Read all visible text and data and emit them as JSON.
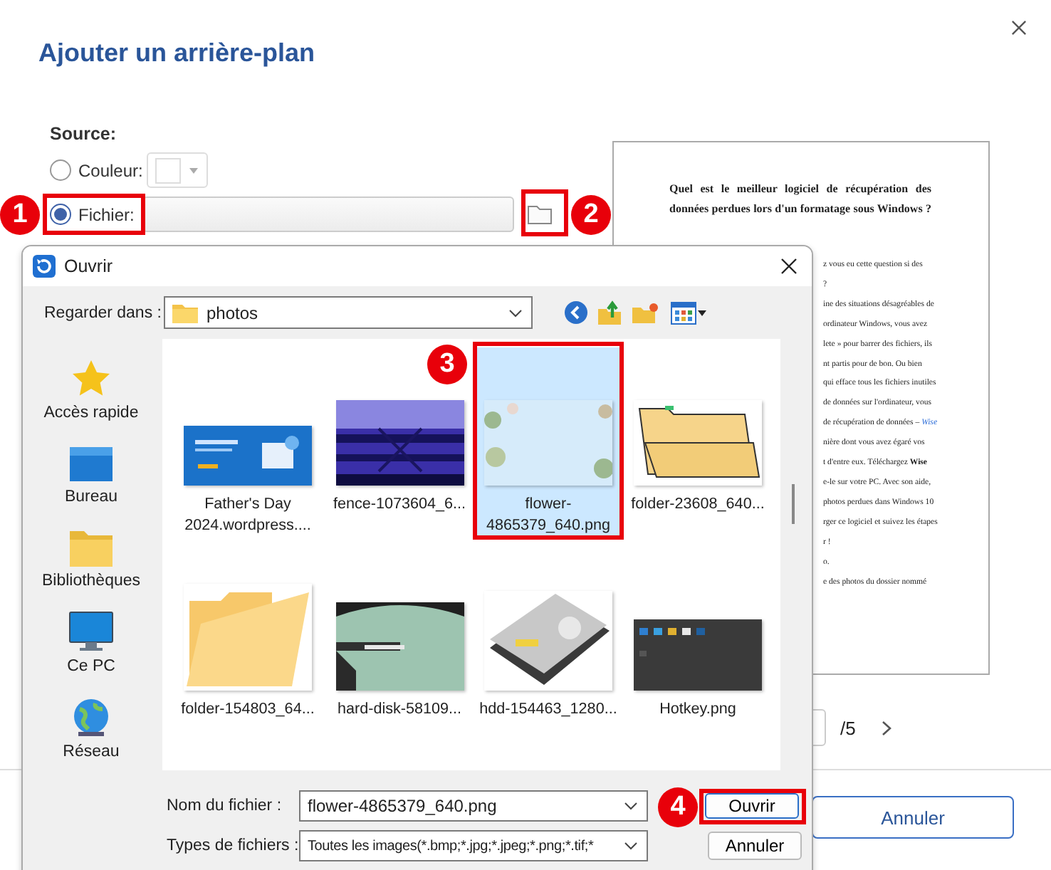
{
  "dialog": {
    "title": "Ajouter un arrière-plan"
  },
  "source": {
    "label": "Source:",
    "options": [
      {
        "kind": "color",
        "label": "Couleur:",
        "selected": false
      },
      {
        "kind": "file",
        "label": "Fichier:",
        "selected": true
      }
    ]
  },
  "preview": {
    "heading": "Quel est le meilleur logiciel de récupération des données perdues lors d'un formatage sous Windows ?",
    "lines": [
      "z vous eu cette question si des",
      "?",
      "ine des situations désagréables de",
      "ordinateur Windows, vous avez",
      "lete » pour barrer des fichiers, ils",
      "nt partis pour de bon. Ou bien",
      "qui efface tous les fichiers inutiles",
      "de données sur l'ordinateur, vous",
      "de récupération de données – *Wise*",
      "nière dont vous avez égaré vos",
      "t d'entre eux. Téléchargez **Wise**",
      "e-le sur votre PC. Avec son aide,",
      "photos perdues dans Windows 10",
      "rger ce logiciel et suivez les étapes",
      "r !",
      "o.",
      "e des photos du dossier nommé"
    ],
    "page_total": "/5"
  },
  "footer": {
    "cancel": "Annuler"
  },
  "open_dialog": {
    "title": "Ouvrir",
    "look_in_label": "Regarder dans :",
    "look_in": "photos",
    "places": [
      {
        "label": "Accès rapide"
      },
      {
        "label": "Bureau"
      },
      {
        "label": "Bibliothèques"
      },
      {
        "label": "Ce PC"
      },
      {
        "label": "Réseau"
      }
    ],
    "files": [
      {
        "name": "Father's Day 2024.wordpress....",
        "selected": false
      },
      {
        "name": "fence-1073604_6...",
        "selected": false
      },
      {
        "name": "flower-4865379_640.png",
        "selected": true
      },
      {
        "name": "folder-23608_640...",
        "selected": false
      },
      {
        "name": "folder-154803_64...",
        "selected": false
      },
      {
        "name": "hard-disk-58109...",
        "selected": false
      },
      {
        "name": "hdd-154463_1280...",
        "selected": false
      },
      {
        "name": "Hotkey.png",
        "selected": false
      }
    ],
    "filename_label": "Nom du fichier :",
    "filename": "flower-4865379_640.png",
    "type_label": "Types de fichiers :",
    "type": "Toutes les images(*.bmp;*.jpg;*.jpeg;*.png;*.tif;*",
    "buttons": [
      {
        "label": "Ouvrir",
        "kind": "primary"
      },
      {
        "label": "Annuler",
        "kind": "secondary"
      }
    ]
  },
  "annotations": [
    {
      "label": "1"
    },
    {
      "label": "2"
    },
    {
      "label": "3"
    },
    {
      "label": "4"
    }
  ]
}
